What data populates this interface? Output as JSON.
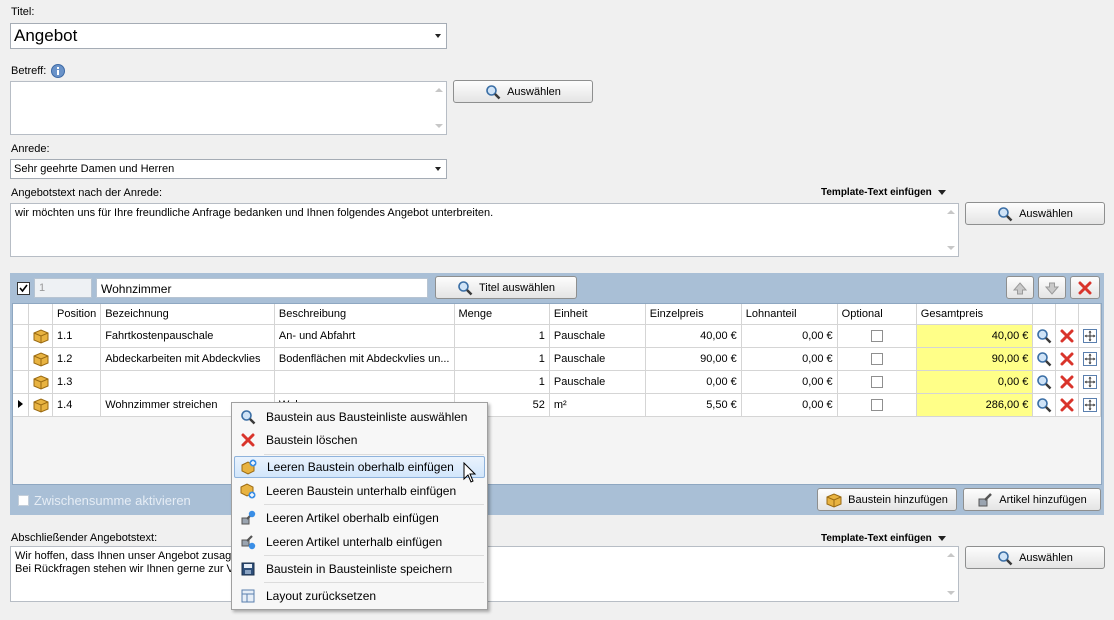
{
  "titel": {
    "label": "Titel:",
    "value": "Angebot"
  },
  "betreff": {
    "label": "Betreff:",
    "value": "",
    "button": "Auswählen"
  },
  "anrede": {
    "label": "Anrede:",
    "value": "Sehr geehrte Damen und Herren"
  },
  "angebotstext": {
    "label": "Angebotstext nach der Anrede:",
    "template_link": "Template-Text einfügen",
    "text": "wir möchten uns für Ihre freundliche Anfrage bedanken und Ihnen folgendes Angebot unterbreiten.",
    "button": "Auswählen"
  },
  "group": {
    "number": "1",
    "title": "Wohnzimmer",
    "title_button": "Titel auswählen",
    "columns": [
      "Position",
      "Bezeichnung",
      "Beschreibung",
      "Menge",
      "Einheit",
      "Einzelpreis",
      "Lohnanteil",
      "Optional",
      "Gesamtpreis"
    ],
    "rows": [
      {
        "position": "1.1",
        "bezeichnung": "Fahrtkostenpauschale",
        "beschreibung": "An- und Abfahrt",
        "menge": "1",
        "einheit": "Pauschale",
        "einzelpreis": "40,00 €",
        "lohnanteil": "0,00 €",
        "gesamtpreis": "40,00 €"
      },
      {
        "position": "1.2",
        "bezeichnung": "Abdeckarbeiten mit Abdeckvlies",
        "beschreibung": "Bodenflächen mit Abdeckvlies un...",
        "menge": "1",
        "einheit": "Pauschale",
        "einzelpreis": "90,00 €",
        "lohnanteil": "0,00 €",
        "gesamtpreis": "90,00 €"
      },
      {
        "position": "1.3",
        "bezeichnung": "",
        "beschreibung": "",
        "menge": "1",
        "einheit": "Pauschale",
        "einzelpreis": "0,00 €",
        "lohnanteil": "0,00 €",
        "gesamtpreis": "0,00 €"
      },
      {
        "position": "1.4",
        "bezeichnung": "Wohnzimmer streichen",
        "beschreibung": "Wohn...",
        "menge": "52",
        "einheit": "m²",
        "einzelpreis": "5,50 €",
        "lohnanteil": "0,00 €",
        "gesamtpreis": "286,00 €"
      }
    ],
    "zwischensumme": "Zwischensumme aktivieren",
    "baustein_button": "Baustein hinzufügen",
    "artikel_button": "Artikel hinzufügen"
  },
  "abschliessend": {
    "label": "Abschließender Angebotstext:",
    "template_link": "Template-Text einfügen",
    "line1": "Wir hoffen, dass Ihnen unser Angebot zusag",
    "line2": "Bei Rückfragen stehen wir Ihnen gerne zur Ve",
    "button": "Auswählen"
  },
  "context_menu": [
    {
      "label": "Baustein aus Bausteinliste auswählen",
      "icon": "search-icon"
    },
    {
      "label": "Baustein löschen",
      "icon": "delete-icon"
    },
    {
      "label": "Leeren Baustein oberhalb einfügen",
      "icon": "insert-block-above-icon"
    },
    {
      "label": "Leeren Baustein unterhalb einfügen",
      "icon": "insert-block-below-icon"
    },
    {
      "label": "Leeren Artikel oberhalb einfügen",
      "icon": "insert-article-above-icon"
    },
    {
      "label": "Leeren Artikel unterhalb einfügen",
      "icon": "insert-article-below-icon"
    },
    {
      "label": "Baustein in Bausteinliste speichern",
      "icon": "save-icon"
    },
    {
      "label": "Layout zurücksetzen",
      "icon": "reset-layout-icon"
    }
  ],
  "colors": {
    "panel": "#a9bfd6",
    "highlight": "#ffff88",
    "delete": "#d9342b"
  }
}
